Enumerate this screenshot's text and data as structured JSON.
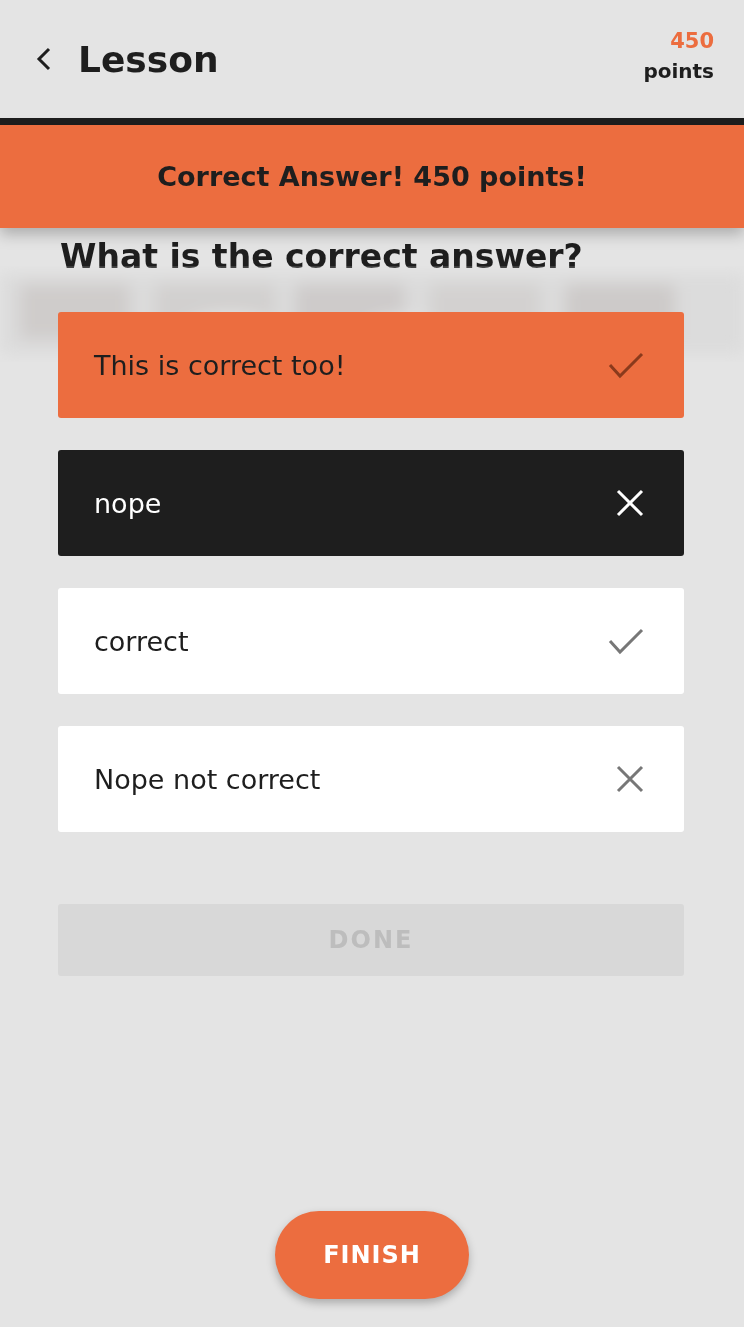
{
  "header": {
    "title": "Lesson",
    "score": "450",
    "score_label": "points"
  },
  "banner": {
    "message": "Correct Answer! 450 points!"
  },
  "question": "What is the correct answer?",
  "options": [
    {
      "label": "This is correct too!",
      "selected": true,
      "correct": true
    },
    {
      "label": "nope",
      "selected": true,
      "correct": false
    },
    {
      "label": "correct",
      "selected": false,
      "correct": true
    },
    {
      "label": "Nope not correct",
      "selected": false,
      "correct": false
    }
  ],
  "done_button": {
    "label": "DONE",
    "disabled": true
  },
  "finish_button": {
    "label": "FINISH"
  }
}
